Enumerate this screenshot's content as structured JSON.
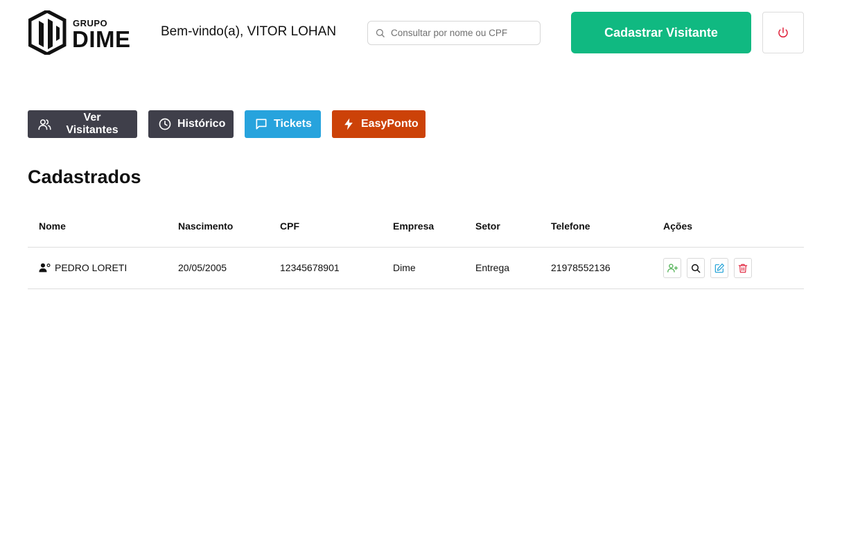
{
  "header": {
    "logo_text_top": "GRUPO",
    "logo_text_main": "DIME",
    "welcome": "Bem-vindo(a), VITOR LOHAN",
    "search_placeholder": "Consultar por nome ou CPF",
    "search_value": "",
    "register_button": "Cadastrar Visitante",
    "logout_icon": "power-icon"
  },
  "nav": {
    "items": [
      {
        "label": "Ver Visitantes",
        "icon": "users-icon",
        "color": "#3f3f4a"
      },
      {
        "label": "Histórico",
        "icon": "clock-icon",
        "color": "#3f3f4a"
      },
      {
        "label": "Tickets",
        "icon": "message-icon",
        "color": "#27a3dd"
      },
      {
        "label": "EasyPonto",
        "icon": "bolt-icon",
        "color": "#cc4208"
      }
    ]
  },
  "section": {
    "title": "Cadastrados"
  },
  "table": {
    "columns": [
      "Nome",
      "Nascimento",
      "CPF",
      "Empresa",
      "Setor",
      "Telefone",
      "Ações"
    ],
    "rows": [
      {
        "nome": "PEDRO LORETI",
        "nascimento": "20/05/2005",
        "cpf": "12345678901",
        "empresa": "Dime",
        "setor": "Entrega",
        "telefone": "21978552136"
      }
    ],
    "actions": [
      {
        "icon": "user-plus-icon",
        "color": "#4caf50"
      },
      {
        "icon": "search-icon",
        "color": "#111111"
      },
      {
        "icon": "edit-icon",
        "color": "#1ea0d6"
      },
      {
        "icon": "trash-icon",
        "color": "#e0243d"
      }
    ]
  },
  "colors": {
    "primary": "#10b981",
    "dark": "#3f3f4a",
    "blue": "#27a3dd",
    "orange": "#cc4208",
    "danger": "#e0243d"
  }
}
